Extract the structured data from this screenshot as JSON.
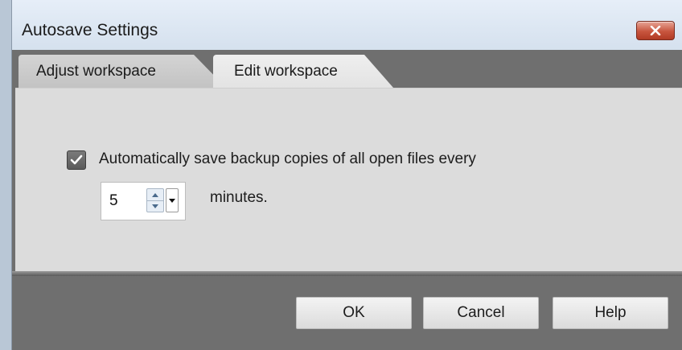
{
  "window": {
    "title": "Autosave Settings",
    "close_icon": "close-icon"
  },
  "tabs": [
    {
      "label": "Adjust workspace",
      "selected": false
    },
    {
      "label": "Edit workspace",
      "selected": true
    }
  ],
  "autosave": {
    "checkbox_checked": true,
    "checkbox_label": "Automatically save backup copies of all open files every",
    "interval_value": "5",
    "unit_label": "minutes."
  },
  "buttons": {
    "ok": "OK",
    "cancel": "Cancel",
    "help": "Help"
  },
  "colors": {
    "dialog_background": "#6f6f6f",
    "panel_background": "#dcdcdc",
    "close_button": "#c8553e"
  }
}
